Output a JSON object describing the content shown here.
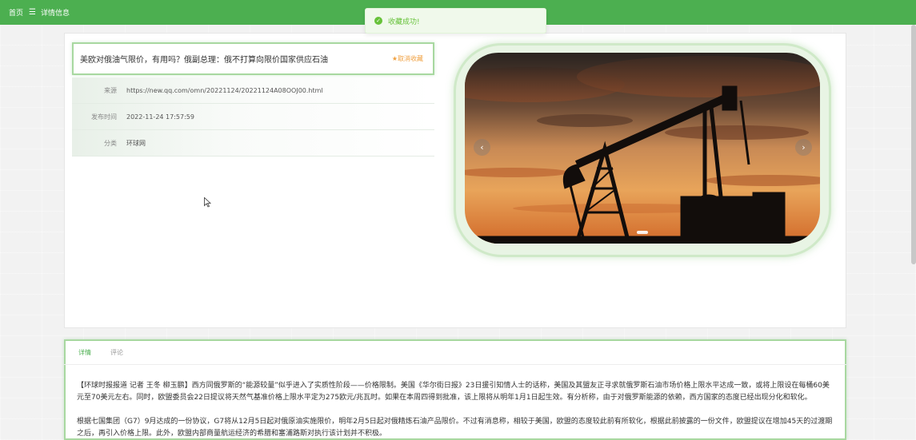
{
  "breadcrumb": {
    "home": "首页",
    "separator": "☰",
    "current": "详情信息"
  },
  "toast": {
    "message": "收藏成功!"
  },
  "article": {
    "title": "美欧对俄油气限价，有用吗？俄副总理：俄不打算向限价国家供应石油",
    "favorite_label": "★取消收藏",
    "source_label": "来源",
    "source_value": "https://new.qq.com/omn/20221124/20221124A08OOJ00.html",
    "time_label": "发布时间",
    "time_value": "2022-11-24 17:57:59",
    "category_label": "分类",
    "category_value": "环球网"
  },
  "carousel": {
    "prev_icon": "chevron-left-icon",
    "next_icon": "chevron-right-icon"
  },
  "tabs": [
    {
      "label": "详情",
      "active": true
    },
    {
      "label": "评论",
      "active": false
    }
  ],
  "body": {
    "paragraph1": "【环球时报报道 记者 王冬 柳玉鹏】西方同俄罗斯的“能源较量”似乎进入了实质性阶段——价格限制。美国《华尔街日报》23日援引知情人士的话称，美国及其盟友正寻求就俄罗斯石油市场价格上限水平达成一致，或将上限设在每桶60美元至70美元左右。同时，欧盟委员会22日提议将天然气基准价格上限水平定为275欧元/兆瓦时。如果在本周四得到批准，该上限将从明年1月1日起生效。有分析称，由于对俄罗斯能源的依赖，西方国家的态度已经出现分化和软化。",
    "paragraph2": "根据七国集团（G7）9月达成的一份协议，G7将从12月5日起对俄原油实施限价，明年2月5日起对俄精炼石油产品限价。不过有消息称，相较于美国，欧盟的态度较此前有所软化，根据此前披露的一份文件，欧盟提议在增加45天的过渡期之后，再引入价格上限。此外，欧盟内部商量航运经济的希腊和塞浦路斯对执行该计划并不积极。"
  },
  "colors": {
    "primary_green": "#4caf50",
    "favorite_orange": "#f0a040"
  }
}
